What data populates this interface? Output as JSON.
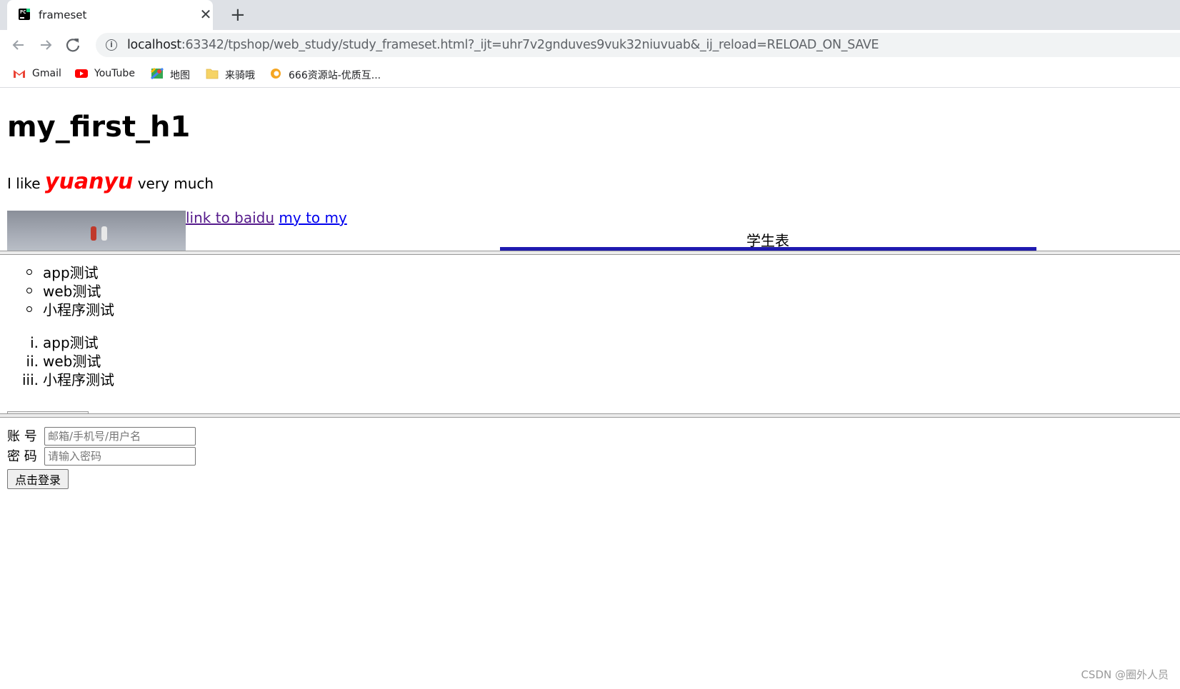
{
  "browser": {
    "tab_title": "frameset",
    "new_tab_symbol": "+",
    "close_symbol": "✕",
    "url_host": "localhost",
    "url_rest": ":63342/tpshop/web_study/study_frameset.html?_ijt=uhr7v2gnduves9vuk32niuvuab&_ij_reload=RELOAD_ON_SAVE",
    "bookmarks": [
      {
        "label": "Gmail",
        "icon": "gmail-icon"
      },
      {
        "label": "YouTube",
        "icon": "youtube-icon"
      },
      {
        "label": "地图",
        "icon": "maps-icon"
      },
      {
        "label": "来骑哦",
        "icon": "folder-icon"
      },
      {
        "label": "666资源站-优质互...",
        "icon": "site-icon"
      }
    ]
  },
  "top_frame": {
    "heading": "my_first_h1",
    "para_before": "I like ",
    "para_emphasis": "yuanyu",
    "para_after": " very much",
    "link1": "link to baidu",
    "link2": "my to my",
    "table_caption": "学生表",
    "table_border_color": "#1f1ab0",
    "emphasis_color": "#ff0000"
  },
  "middle_frame": {
    "unordered_list": [
      "app测试",
      "web测试",
      "小程序测试"
    ],
    "ordered_list": [
      {
        "marker": "i.",
        "text": "app测试"
      },
      {
        "marker": "ii.",
        "text": "web测试"
      },
      {
        "marker": "iii.",
        "text": "小程序测试"
      }
    ]
  },
  "bottom_frame": {
    "account_label": "账 号",
    "account_placeholder": "邮箱/手机号/用户名",
    "password_label": "密 码",
    "password_placeholder": "请输入密码",
    "login_button": "点击登录"
  },
  "watermark": "CSDN @圈外人员"
}
